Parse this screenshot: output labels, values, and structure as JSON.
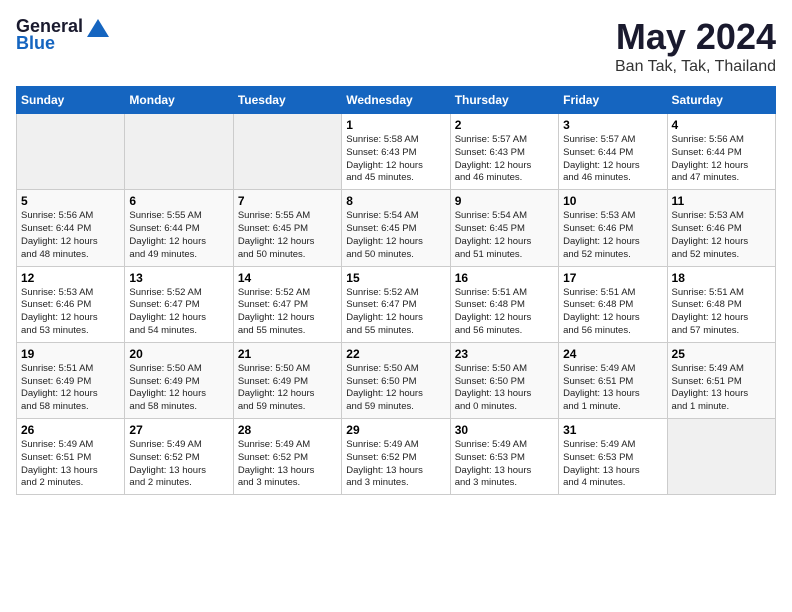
{
  "logo": {
    "general": "General",
    "blue": "Blue"
  },
  "title": "May 2024",
  "location": "Ban Tak, Tak, Thailand",
  "headers": [
    "Sunday",
    "Monday",
    "Tuesday",
    "Wednesday",
    "Thursday",
    "Friday",
    "Saturday"
  ],
  "weeks": [
    [
      {
        "day": "",
        "info": ""
      },
      {
        "day": "",
        "info": ""
      },
      {
        "day": "",
        "info": ""
      },
      {
        "day": "1",
        "info": "Sunrise: 5:58 AM\nSunset: 6:43 PM\nDaylight: 12 hours\nand 45 minutes."
      },
      {
        "day": "2",
        "info": "Sunrise: 5:57 AM\nSunset: 6:43 PM\nDaylight: 12 hours\nand 46 minutes."
      },
      {
        "day": "3",
        "info": "Sunrise: 5:57 AM\nSunset: 6:44 PM\nDaylight: 12 hours\nand 46 minutes."
      },
      {
        "day": "4",
        "info": "Sunrise: 5:56 AM\nSunset: 6:44 PM\nDaylight: 12 hours\nand 47 minutes."
      }
    ],
    [
      {
        "day": "5",
        "info": "Sunrise: 5:56 AM\nSunset: 6:44 PM\nDaylight: 12 hours\nand 48 minutes."
      },
      {
        "day": "6",
        "info": "Sunrise: 5:55 AM\nSunset: 6:44 PM\nDaylight: 12 hours\nand 49 minutes."
      },
      {
        "day": "7",
        "info": "Sunrise: 5:55 AM\nSunset: 6:45 PM\nDaylight: 12 hours\nand 50 minutes."
      },
      {
        "day": "8",
        "info": "Sunrise: 5:54 AM\nSunset: 6:45 PM\nDaylight: 12 hours\nand 50 minutes."
      },
      {
        "day": "9",
        "info": "Sunrise: 5:54 AM\nSunset: 6:45 PM\nDaylight: 12 hours\nand 51 minutes."
      },
      {
        "day": "10",
        "info": "Sunrise: 5:53 AM\nSunset: 6:46 PM\nDaylight: 12 hours\nand 52 minutes."
      },
      {
        "day": "11",
        "info": "Sunrise: 5:53 AM\nSunset: 6:46 PM\nDaylight: 12 hours\nand 52 minutes."
      }
    ],
    [
      {
        "day": "12",
        "info": "Sunrise: 5:53 AM\nSunset: 6:46 PM\nDaylight: 12 hours\nand 53 minutes."
      },
      {
        "day": "13",
        "info": "Sunrise: 5:52 AM\nSunset: 6:47 PM\nDaylight: 12 hours\nand 54 minutes."
      },
      {
        "day": "14",
        "info": "Sunrise: 5:52 AM\nSunset: 6:47 PM\nDaylight: 12 hours\nand 55 minutes."
      },
      {
        "day": "15",
        "info": "Sunrise: 5:52 AM\nSunset: 6:47 PM\nDaylight: 12 hours\nand 55 minutes."
      },
      {
        "day": "16",
        "info": "Sunrise: 5:51 AM\nSunset: 6:48 PM\nDaylight: 12 hours\nand 56 minutes."
      },
      {
        "day": "17",
        "info": "Sunrise: 5:51 AM\nSunset: 6:48 PM\nDaylight: 12 hours\nand 56 minutes."
      },
      {
        "day": "18",
        "info": "Sunrise: 5:51 AM\nSunset: 6:48 PM\nDaylight: 12 hours\nand 57 minutes."
      }
    ],
    [
      {
        "day": "19",
        "info": "Sunrise: 5:51 AM\nSunset: 6:49 PM\nDaylight: 12 hours\nand 58 minutes."
      },
      {
        "day": "20",
        "info": "Sunrise: 5:50 AM\nSunset: 6:49 PM\nDaylight: 12 hours\nand 58 minutes."
      },
      {
        "day": "21",
        "info": "Sunrise: 5:50 AM\nSunset: 6:49 PM\nDaylight: 12 hours\nand 59 minutes."
      },
      {
        "day": "22",
        "info": "Sunrise: 5:50 AM\nSunset: 6:50 PM\nDaylight: 12 hours\nand 59 minutes."
      },
      {
        "day": "23",
        "info": "Sunrise: 5:50 AM\nSunset: 6:50 PM\nDaylight: 13 hours\nand 0 minutes."
      },
      {
        "day": "24",
        "info": "Sunrise: 5:49 AM\nSunset: 6:51 PM\nDaylight: 13 hours\nand 1 minute."
      },
      {
        "day": "25",
        "info": "Sunrise: 5:49 AM\nSunset: 6:51 PM\nDaylight: 13 hours\nand 1 minute."
      }
    ],
    [
      {
        "day": "26",
        "info": "Sunrise: 5:49 AM\nSunset: 6:51 PM\nDaylight: 13 hours\nand 2 minutes."
      },
      {
        "day": "27",
        "info": "Sunrise: 5:49 AM\nSunset: 6:52 PM\nDaylight: 13 hours\nand 2 minutes."
      },
      {
        "day": "28",
        "info": "Sunrise: 5:49 AM\nSunset: 6:52 PM\nDaylight: 13 hours\nand 3 minutes."
      },
      {
        "day": "29",
        "info": "Sunrise: 5:49 AM\nSunset: 6:52 PM\nDaylight: 13 hours\nand 3 minutes."
      },
      {
        "day": "30",
        "info": "Sunrise: 5:49 AM\nSunset: 6:53 PM\nDaylight: 13 hours\nand 3 minutes."
      },
      {
        "day": "31",
        "info": "Sunrise: 5:49 AM\nSunset: 6:53 PM\nDaylight: 13 hours\nand 4 minutes."
      },
      {
        "day": "",
        "info": ""
      }
    ]
  ]
}
